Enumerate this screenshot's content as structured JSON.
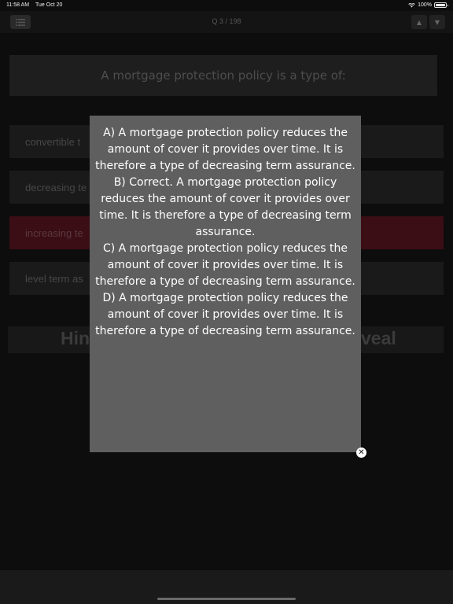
{
  "status_bar": {
    "time": "11:58 AM",
    "date": "Tue Oct 20",
    "battery": "100%"
  },
  "nav": {
    "title": "Q 3 / 198",
    "up_arrow": "▲",
    "down_arrow": "▼"
  },
  "question": {
    "text": "A mortgage protection policy is a type of:"
  },
  "options": [
    {
      "label": "convertible t"
    },
    {
      "label": "decreasing te"
    },
    {
      "label": "increasing te"
    },
    {
      "label": "level term as"
    }
  ],
  "actions": {
    "hint_label": "Hin",
    "reveal_label": "veal"
  },
  "explanation": {
    "items": [
      "A) A mortgage protection policy reduces the amount of cover it provides over time. It is therefore a type of decreasing term assurance.",
      "B) Correct. A mortgage protection policy reduces the amount of cover it provides over time. It is therefore a type of decreasing term assurance.",
      "C) A mortgage protection policy reduces the amount of cover it provides over time. It is therefore a type of decreasing term assurance.",
      "D) A mortgage protection policy reduces the amount of cover it provides over time. It is therefore a type of decreasing term assurance."
    ],
    "close_symbol": "✕"
  },
  "colors": {
    "background": "#0d0d0d",
    "modal": "#5f5f5f",
    "selected_option": "#3b0d15"
  }
}
